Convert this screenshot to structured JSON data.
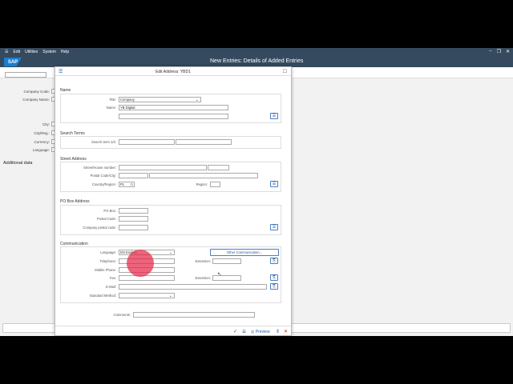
{
  "menu": {
    "items": [
      "Edit",
      "Utilities",
      "System",
      "Help"
    ]
  },
  "window": {
    "title": "New Entries: Details of Added Entries",
    "logo": "SAP"
  },
  "background": {
    "labels": [
      "Company Code:",
      "Company Name:"
    ],
    "section": "Additional data",
    "labels2": [
      "City:",
      "City/Reg.:",
      "Currency:",
      "Language:"
    ]
  },
  "dialog": {
    "title": "Edit Address:  YBD1",
    "name": {
      "header": "Name",
      "title_label": "Title:",
      "title_value": "Company",
      "name_label": "Name:",
      "name_value": "YB Digital"
    },
    "search": {
      "header": "Search Terms",
      "label": "Search term 1/2:"
    },
    "street": {
      "header": "Street Address",
      "street_label": "Street/House number:",
      "postal_label": "Postal Code/City:",
      "country_label": "Country/Region:",
      "country_value": "PL",
      "region_label": "Region:"
    },
    "pobox": {
      "header": "PO Box Address",
      "po_label": "PO Box:",
      "postal_label": "Postal Code:",
      "company_label": "Company postal code:"
    },
    "comm": {
      "header": "Communication",
      "language_label": "Language:",
      "language_value": "EN English",
      "other_button": "Other Communication...",
      "telephone_label": "Telephone:",
      "extension_label": "Extension:",
      "mobile_label": "Mobile Phone:",
      "fax_label": "Fax:",
      "fax_ext_label": "Extension:",
      "email_label": "E-Mail:",
      "method_label": "Standard Method:"
    },
    "comments_label": "Comments:",
    "footer": {
      "preview": "Preview"
    }
  },
  "colors": {
    "shell": "#354a5f",
    "accent": "#1a5ba3",
    "cursor": "#e62846"
  }
}
